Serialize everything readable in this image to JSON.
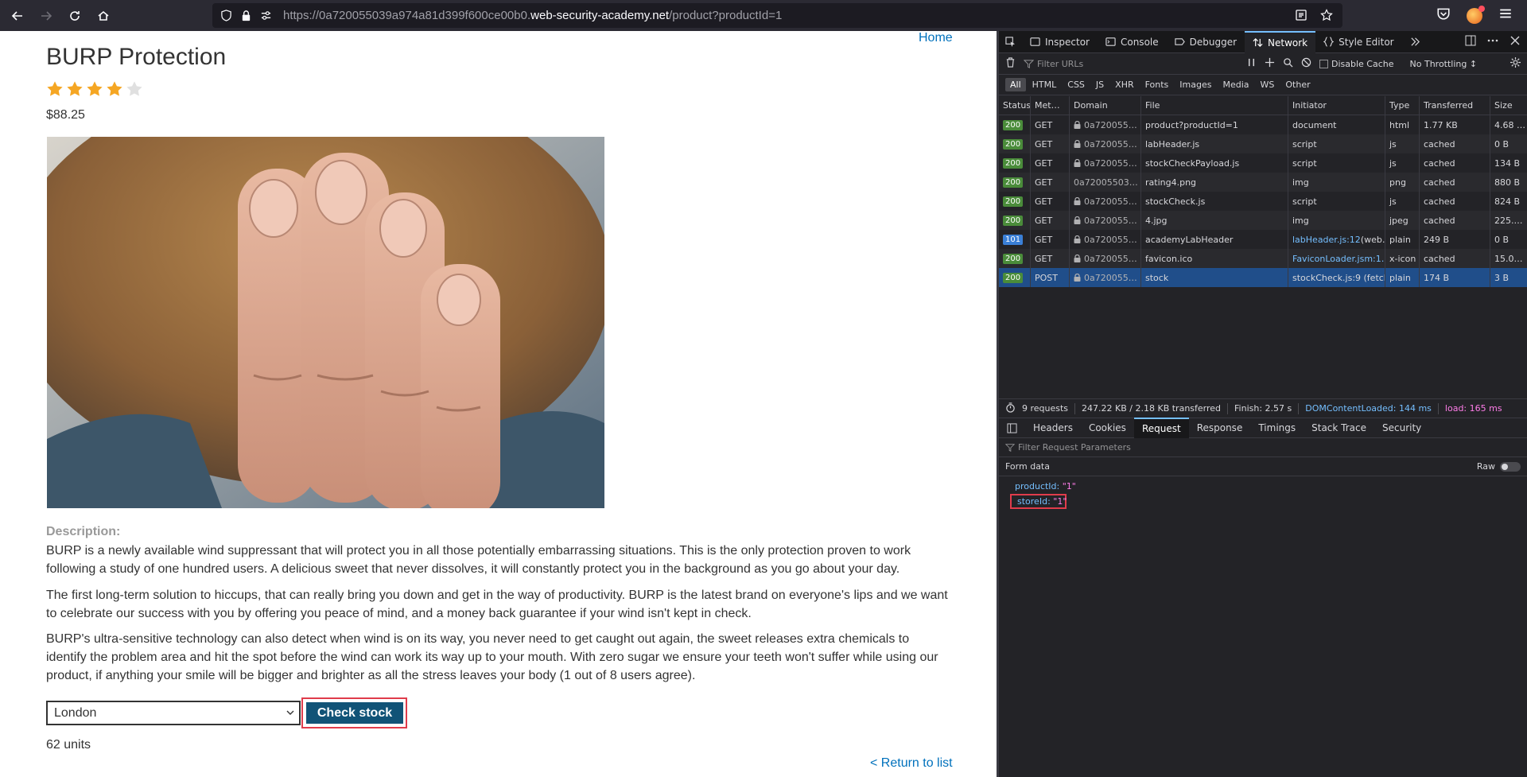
{
  "browser": {
    "url_prefix": "https://0a720055039a974a81d399f600ce00b0.",
    "url_host": "web-security-academy.net",
    "url_path": "/product?productId=1"
  },
  "page": {
    "home_link": "Home",
    "title": "BURP Protection",
    "rating": 4,
    "rating_max": 5,
    "price": "$88.25",
    "description_label": "Description:",
    "paragraphs": [
      "BURP is a newly available wind suppressant that will protect you in all those potentially embarrassing situations. This is the only protection proven to work following a study of one hundred users. A delicious sweet that never dissolves, it will constantly protect you in the background as you go about your day.",
      "The first long-term solution to hiccups, that can really bring you down and get in the way of productivity. BURP is the latest brand on everyone's lips and we want to celebrate our success with you by offering you peace of mind, and a money back guarantee if your wind isn't kept in check.",
      "BURP's ultra-sensitive technology can also detect when wind is on its way, you never need to get caught out again, the sweet releases extra chemicals to identify the problem area and hit the spot before the wind can work its way up to your mouth. With zero sugar we ensure your teeth won't suffer while using our product, if anything your smile will be bigger and brighter as all the stress leaves your body (1 out of 8 users agree)."
    ],
    "store_selected": "London",
    "check_stock_label": "Check stock",
    "stock_result": "62 units",
    "return_link": "< Return to list"
  },
  "devtools": {
    "tabs": [
      "Inspector",
      "Console",
      "Debugger",
      "Network",
      "Style Editor"
    ],
    "active_tab": "Network",
    "filter_placeholder": "Filter URLs",
    "disable_cache": "Disable Cache",
    "throttling": "No Throttling ↕",
    "type_filters": [
      "All",
      "HTML",
      "CSS",
      "JS",
      "XHR",
      "Fonts",
      "Images",
      "Media",
      "WS",
      "Other"
    ],
    "columns": [
      "Status",
      "Met…",
      "Domain",
      "File",
      "Initiator",
      "Type",
      "Transferred",
      "Size"
    ],
    "requests": [
      {
        "status": "200",
        "method": "GET",
        "domain": "0a720055…",
        "lock": true,
        "file": "product?productId=1",
        "initiator": "document",
        "init_link": false,
        "type": "html",
        "transferred": "1.77 KB",
        "size": "4.68 …"
      },
      {
        "status": "200",
        "method": "GET",
        "domain": "0a720055…",
        "lock": true,
        "file": "labHeader.js",
        "initiator": "script",
        "init_link": false,
        "type": "js",
        "transferred": "cached",
        "size": "0 B"
      },
      {
        "status": "200",
        "method": "GET",
        "domain": "0a720055…",
        "lock": true,
        "file": "stockCheckPayload.js",
        "initiator": "script",
        "init_link": false,
        "type": "js",
        "transferred": "cached",
        "size": "134 B"
      },
      {
        "status": "200",
        "method": "GET",
        "domain": "0a72005503…",
        "lock": false,
        "file": "rating4.png",
        "initiator": "img",
        "init_link": false,
        "type": "png",
        "transferred": "cached",
        "size": "880 B"
      },
      {
        "status": "200",
        "method": "GET",
        "domain": "0a720055…",
        "lock": true,
        "file": "stockCheck.js",
        "initiator": "script",
        "init_link": false,
        "type": "js",
        "transferred": "cached",
        "size": "824 B"
      },
      {
        "status": "200",
        "method": "GET",
        "domain": "0a720055…",
        "lock": true,
        "file": "4.jpg",
        "initiator": "img",
        "init_link": false,
        "type": "jpeg",
        "transferred": "cached",
        "size": "225.…"
      },
      {
        "status": "101",
        "method": "GET",
        "domain": "0a720055…",
        "lock": true,
        "file": "academyLabHeader",
        "initiator": "labHeader.js:12",
        "init_extra": " (web…",
        "init_link": true,
        "type": "plain",
        "transferred": "249 B",
        "size": "0 B"
      },
      {
        "status": "200",
        "method": "GET",
        "domain": "0a720055…",
        "lock": true,
        "file": "favicon.ico",
        "initiator": "FaviconLoader.jsm:1…",
        "init_link": true,
        "type": "x-icon",
        "transferred": "cached",
        "size": "15.0…"
      },
      {
        "status": "200",
        "method": "POST",
        "domain": "0a720055…",
        "lock": true,
        "file": "stock",
        "initiator": "stockCheck.js:9 (fetch)",
        "init_link": false,
        "type": "plain",
        "transferred": "174 B",
        "size": "3 B",
        "selected": true
      }
    ],
    "summary": {
      "requests": "9 requests",
      "transferred": "247.22 KB / 2.18 KB transferred",
      "finish": "Finish: 2.57 s",
      "dcl": "DOMContentLoaded: 144 ms",
      "load": "load: 165 ms"
    },
    "detail_tabs": [
      "Headers",
      "Cookies",
      "Request",
      "Response",
      "Timings",
      "Stack Trace",
      "Security"
    ],
    "active_detail_tab": "Request",
    "filter_params_placeholder": "Filter Request Parameters",
    "form_data_label": "Form data",
    "raw_label": "Raw",
    "params": [
      {
        "key": "productId",
        "value": "\"1\""
      },
      {
        "key": "storeId",
        "value": "\"1\""
      }
    ]
  }
}
